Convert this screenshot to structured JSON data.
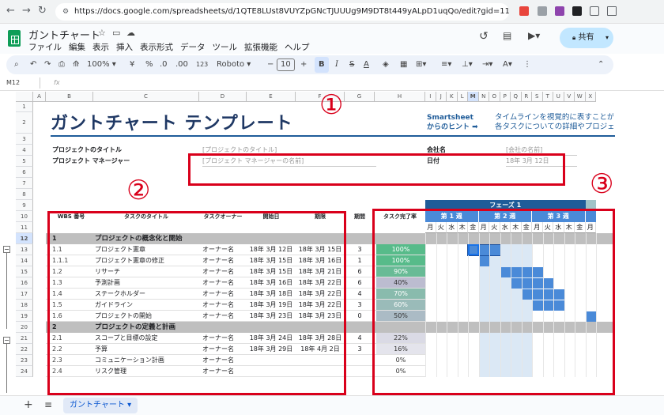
{
  "browser": {
    "url": "https://docs.google.com/spreadsheets/d/1QTE8LUst8VUYZpGNcTJUUUg9M9DT8t449yALpD1uqQo/edit?gid=1115838130#gid=1115838130"
  },
  "doc": {
    "title": "ガントチャート",
    "menus": [
      "ファイル",
      "編集",
      "表示",
      "挿入",
      "表示形式",
      "データ",
      "ツール",
      "拡張機能",
      "ヘルプ"
    ],
    "share": "共有"
  },
  "toolbar": {
    "zoom": "100%",
    "currency": "¥",
    "percent": "%",
    "dec_less": ".0",
    "dec_more": ".00",
    "num": "123",
    "font": "Roboto",
    "size": "10"
  },
  "formula": {
    "namebox": "M12",
    "fx": "fx"
  },
  "columns": [
    "A",
    "B",
    "C",
    "D",
    "E",
    "F",
    "G",
    "H",
    "I",
    "J",
    "K",
    "L",
    "M",
    "N",
    "O",
    "P",
    "Q",
    "R",
    "S",
    "T",
    "U",
    "V",
    "W",
    "X"
  ],
  "rownums": [
    "1",
    "2",
    "3",
    "4",
    "5",
    "6",
    "7",
    "8",
    "9",
    "10",
    "11",
    "12",
    "13",
    "14",
    "15",
    "16",
    "17",
    "18",
    "19",
    "20",
    "21",
    "22",
    "23",
    "24"
  ],
  "header": {
    "title": "ガントチャート テンプレート",
    "tip1": "Smartsheet",
    "tip2": "からのヒント ➡",
    "tip3": "タイムラインを視覚的に表すことが",
    "tip4": "各タスクについての詳細やプロジェ"
  },
  "info": {
    "proj_title_label": "プロジェクトのタイトル",
    "proj_title_ph": "[プロジェクトのタイトル]",
    "pm_label": "プロジェクト マネージャー",
    "pm_ph": "[プロジェクト マネージャーの名前]",
    "company_label": "会社名",
    "company_ph": "[会社の名前]",
    "date_label": "日付",
    "date_val": "18年 3月 12日"
  },
  "table_headers": {
    "wbs": "WBS 番号",
    "task": "タスクのタイトル",
    "owner": "タスクオーナー",
    "start": "開始日",
    "due": "期限",
    "duration": "期間",
    "pct": "タスク完了率"
  },
  "gantt": {
    "phase": "フェーズ 1",
    "weeks": [
      "第 1 週",
      "第 2 週",
      "第 3 週"
    ],
    "days": [
      "月",
      "火",
      "水",
      "木",
      "金",
      "月",
      "火",
      "水",
      "木",
      "金",
      "月",
      "火",
      "水",
      "木",
      "金",
      "月"
    ]
  },
  "rows": [
    {
      "wbs": "1",
      "task": "プロジェクトの概念化と開始",
      "owner": "",
      "start": "",
      "due": "",
      "dur": "",
      "pct": "",
      "section": true
    },
    {
      "wbs": "1.1",
      "task": "プロジェクト憲章",
      "owner": "オーナー名",
      "start": "18年 3月 12日",
      "due": "18年 3月 15日",
      "dur": "3",
      "pct": "100%",
      "level": 1.0
    },
    {
      "wbs": "1.1.1",
      "task": "プロジェクト憲章の修正",
      "owner": "オーナー名",
      "start": "18年 3月 15日",
      "due": "18年 3月 16日",
      "dur": "1",
      "pct": "100%",
      "level": 1.0
    },
    {
      "wbs": "1.2",
      "task": "リサーチ",
      "owner": "オーナー名",
      "start": "18年 3月 15日",
      "due": "18年 3月 21日",
      "dur": "6",
      "pct": "90%",
      "level": 0.9
    },
    {
      "wbs": "1.3",
      "task": "予測計画",
      "owner": "オーナー名",
      "start": "18年 3月 16日",
      "due": "18年 3月 22日",
      "dur": "6",
      "pct": "40%",
      "level": 0.4
    },
    {
      "wbs": "1.4",
      "task": "ステークホルダー",
      "owner": "オーナー名",
      "start": "18年 3月 18日",
      "due": "18年 3月 22日",
      "dur": "4",
      "pct": "70%",
      "level": 0.7
    },
    {
      "wbs": "1.5",
      "task": "ガイドライン",
      "owner": "オーナー名",
      "start": "18年 3月 19日",
      "due": "18年 3月 22日",
      "dur": "3",
      "pct": "60%",
      "level": 0.6
    },
    {
      "wbs": "1.6",
      "task": "プロジェクトの開始",
      "owner": "オーナー名",
      "start": "18年 3月 23日",
      "due": "18年 3月 23日",
      "dur": "0",
      "pct": "50%",
      "level": 0.5
    },
    {
      "wbs": "2",
      "task": "プロジェクトの定義と計画",
      "owner": "",
      "start": "",
      "due": "",
      "dur": "",
      "pct": "",
      "section": true
    },
    {
      "wbs": "2.1",
      "task": "スコープと目標の設定",
      "owner": "オーナー名",
      "start": "18年 3月 24日",
      "due": "18年 3月 28日",
      "dur": "4",
      "pct": "22%",
      "level": 0.22
    },
    {
      "wbs": "2.2",
      "task": "予算",
      "owner": "オーナー名",
      "start": "18年 3月 29日",
      "due": "18年 4月 2日",
      "dur": "3",
      "pct": "16%",
      "level": 0.16
    },
    {
      "wbs": "2.3",
      "task": "コミュニケーション計画",
      "owner": "オーナー名",
      "start": "",
      "due": "",
      "dur": "",
      "pct": "0%",
      "level": 0
    },
    {
      "wbs": "2.4",
      "task": "リスク管理",
      "owner": "オーナー名",
      "start": "",
      "due": "",
      "dur": "",
      "pct": "0%",
      "level": 0
    }
  ],
  "annotations": [
    "①",
    "②",
    "③"
  ],
  "sheet_tab": "ガントチャート",
  "colors": {
    "title": "#1f3864",
    "phase": "#1f5c99",
    "bar": "#4a8ad8",
    "section": "#bfbfbf",
    "pct_high": "#57bb8a",
    "annot": "#d9001b"
  }
}
